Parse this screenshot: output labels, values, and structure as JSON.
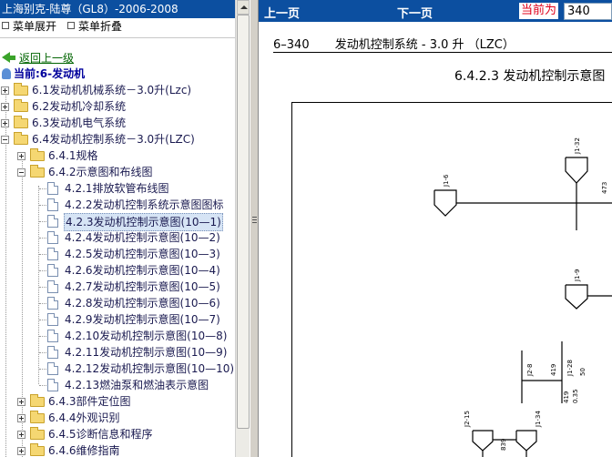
{
  "app_title": "上海别克-陆尊（GL8）-2006-2008",
  "menu": {
    "expand": "菜单展开",
    "collapse": "菜单折叠"
  },
  "back_link": "返回上一级",
  "current": "当前:6-发动机",
  "tree": [
    {
      "label": "6.1发动机机械系统－3.0升(Lzc)"
    },
    {
      "label": "6.2发动机冷却系统"
    },
    {
      "label": "6.3发动机电气系统"
    },
    {
      "label": "6.4发动机控制系统－3.0升(LZC)"
    },
    {
      "label": "6.4.1规格"
    },
    {
      "label": "6.4.2示意图和布线图"
    },
    {
      "label": "4.2.1排放软管布线图"
    },
    {
      "label": "4.2.2发动机控制系统示意图图标"
    },
    {
      "label": "4.2.3发动机控制示意图(10—1)"
    },
    {
      "label": "4.2.4发动机控制示意图(10—2)"
    },
    {
      "label": "4.2.5发动机控制示意图(10—3)"
    },
    {
      "label": "4.2.6发动机控制示意图(10—4)"
    },
    {
      "label": "4.2.7发动机控制示意图(10—5)"
    },
    {
      "label": "4.2.8发动机控制示意图(10—6)"
    },
    {
      "label": "4.2.9发动机控制示意图(10—7)"
    },
    {
      "label": "4.2.10发动机控制示意图(10—8)"
    },
    {
      "label": "4.2.11发动机控制示意图(10—9)"
    },
    {
      "label": "4.2.12发动机控制示意图(10—10)"
    },
    {
      "label": "4.2.13燃油泵和燃油表示意图"
    },
    {
      "label": "6.4.3部件定位图"
    },
    {
      "label": "6.4.4外观识别"
    },
    {
      "label": "6.4.5诊断信息和程序"
    },
    {
      "label": "6.4.6维修指南"
    }
  ],
  "nav": {
    "prev": "上一页",
    "next": "下一页",
    "current_label": "当前为",
    "page_value": "340"
  },
  "document": {
    "page_number": "6–340",
    "section": "发动机控制系统 - 3.0 升 （LZC）",
    "diagram_title": "6.4.2.3 发动机控制示意图",
    "labels": {
      "j16": "J1-6",
      "j132": "J1-32",
      "j19": "J1-9",
      "j128": "J1-28",
      "j134": "J1-34",
      "j215": "J2-15",
      "j28": "J2-8",
      "w473": "473",
      "w419a": "419",
      "w419b": "419",
      "w50": "50",
      "w035": "0.35",
      "w839": "839"
    }
  }
}
